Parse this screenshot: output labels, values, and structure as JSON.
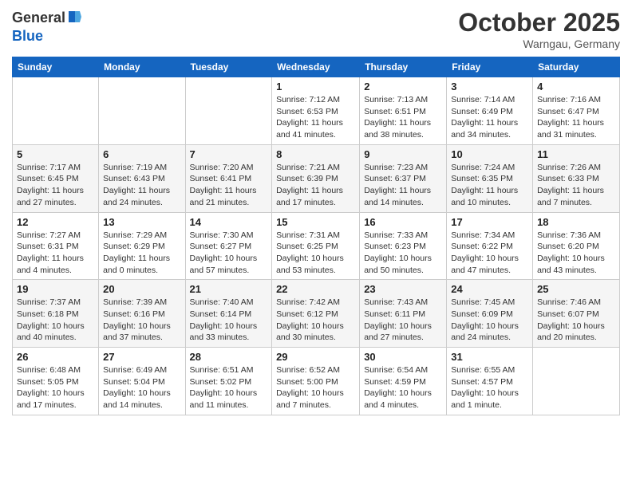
{
  "header": {
    "logo_general": "General",
    "logo_blue": "Blue",
    "month": "October 2025",
    "location": "Warngau, Germany"
  },
  "weekdays": [
    "Sunday",
    "Monday",
    "Tuesday",
    "Wednesday",
    "Thursday",
    "Friday",
    "Saturday"
  ],
  "weeks": [
    [
      {
        "day": "",
        "info": ""
      },
      {
        "day": "",
        "info": ""
      },
      {
        "day": "",
        "info": ""
      },
      {
        "day": "1",
        "info": "Sunrise: 7:12 AM\nSunset: 6:53 PM\nDaylight: 11 hours and 41 minutes."
      },
      {
        "day": "2",
        "info": "Sunrise: 7:13 AM\nSunset: 6:51 PM\nDaylight: 11 hours and 38 minutes."
      },
      {
        "day": "3",
        "info": "Sunrise: 7:14 AM\nSunset: 6:49 PM\nDaylight: 11 hours and 34 minutes."
      },
      {
        "day": "4",
        "info": "Sunrise: 7:16 AM\nSunset: 6:47 PM\nDaylight: 11 hours and 31 minutes."
      }
    ],
    [
      {
        "day": "5",
        "info": "Sunrise: 7:17 AM\nSunset: 6:45 PM\nDaylight: 11 hours and 27 minutes."
      },
      {
        "day": "6",
        "info": "Sunrise: 7:19 AM\nSunset: 6:43 PM\nDaylight: 11 hours and 24 minutes."
      },
      {
        "day": "7",
        "info": "Sunrise: 7:20 AM\nSunset: 6:41 PM\nDaylight: 11 hours and 21 minutes."
      },
      {
        "day": "8",
        "info": "Sunrise: 7:21 AM\nSunset: 6:39 PM\nDaylight: 11 hours and 17 minutes."
      },
      {
        "day": "9",
        "info": "Sunrise: 7:23 AM\nSunset: 6:37 PM\nDaylight: 11 hours and 14 minutes."
      },
      {
        "day": "10",
        "info": "Sunrise: 7:24 AM\nSunset: 6:35 PM\nDaylight: 11 hours and 10 minutes."
      },
      {
        "day": "11",
        "info": "Sunrise: 7:26 AM\nSunset: 6:33 PM\nDaylight: 11 hours and 7 minutes."
      }
    ],
    [
      {
        "day": "12",
        "info": "Sunrise: 7:27 AM\nSunset: 6:31 PM\nDaylight: 11 hours and 4 minutes."
      },
      {
        "day": "13",
        "info": "Sunrise: 7:29 AM\nSunset: 6:29 PM\nDaylight: 11 hours and 0 minutes."
      },
      {
        "day": "14",
        "info": "Sunrise: 7:30 AM\nSunset: 6:27 PM\nDaylight: 10 hours and 57 minutes."
      },
      {
        "day": "15",
        "info": "Sunrise: 7:31 AM\nSunset: 6:25 PM\nDaylight: 10 hours and 53 minutes."
      },
      {
        "day": "16",
        "info": "Sunrise: 7:33 AM\nSunset: 6:23 PM\nDaylight: 10 hours and 50 minutes."
      },
      {
        "day": "17",
        "info": "Sunrise: 7:34 AM\nSunset: 6:22 PM\nDaylight: 10 hours and 47 minutes."
      },
      {
        "day": "18",
        "info": "Sunrise: 7:36 AM\nSunset: 6:20 PM\nDaylight: 10 hours and 43 minutes."
      }
    ],
    [
      {
        "day": "19",
        "info": "Sunrise: 7:37 AM\nSunset: 6:18 PM\nDaylight: 10 hours and 40 minutes."
      },
      {
        "day": "20",
        "info": "Sunrise: 7:39 AM\nSunset: 6:16 PM\nDaylight: 10 hours and 37 minutes."
      },
      {
        "day": "21",
        "info": "Sunrise: 7:40 AM\nSunset: 6:14 PM\nDaylight: 10 hours and 33 minutes."
      },
      {
        "day": "22",
        "info": "Sunrise: 7:42 AM\nSunset: 6:12 PM\nDaylight: 10 hours and 30 minutes."
      },
      {
        "day": "23",
        "info": "Sunrise: 7:43 AM\nSunset: 6:11 PM\nDaylight: 10 hours and 27 minutes."
      },
      {
        "day": "24",
        "info": "Sunrise: 7:45 AM\nSunset: 6:09 PM\nDaylight: 10 hours and 24 minutes."
      },
      {
        "day": "25",
        "info": "Sunrise: 7:46 AM\nSunset: 6:07 PM\nDaylight: 10 hours and 20 minutes."
      }
    ],
    [
      {
        "day": "26",
        "info": "Sunrise: 6:48 AM\nSunset: 5:05 PM\nDaylight: 10 hours and 17 minutes."
      },
      {
        "day": "27",
        "info": "Sunrise: 6:49 AM\nSunset: 5:04 PM\nDaylight: 10 hours and 14 minutes."
      },
      {
        "day": "28",
        "info": "Sunrise: 6:51 AM\nSunset: 5:02 PM\nDaylight: 10 hours and 11 minutes."
      },
      {
        "day": "29",
        "info": "Sunrise: 6:52 AM\nSunset: 5:00 PM\nDaylight: 10 hours and 7 minutes."
      },
      {
        "day": "30",
        "info": "Sunrise: 6:54 AM\nSunset: 4:59 PM\nDaylight: 10 hours and 4 minutes."
      },
      {
        "day": "31",
        "info": "Sunrise: 6:55 AM\nSunset: 4:57 PM\nDaylight: 10 hours and 1 minute."
      },
      {
        "day": "",
        "info": ""
      }
    ]
  ]
}
